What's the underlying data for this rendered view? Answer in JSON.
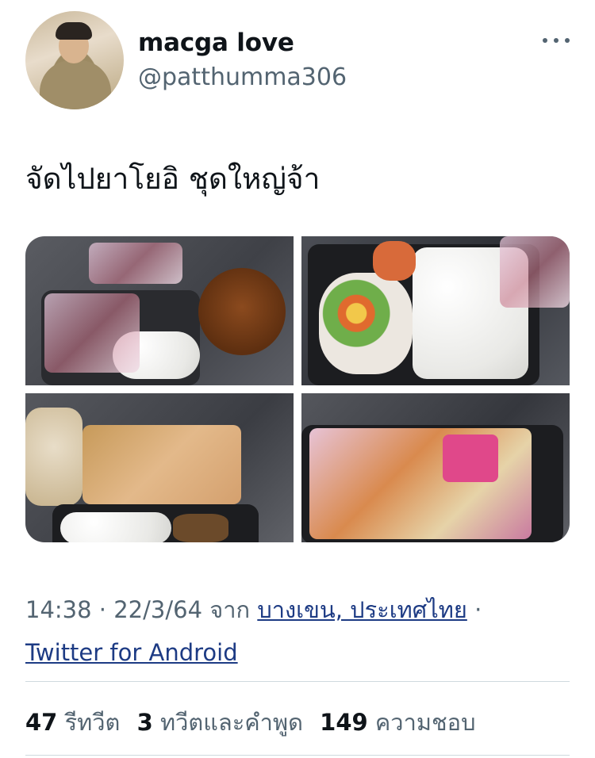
{
  "tweet": {
    "display_name": "macga love",
    "handle": "@patthumma306",
    "text": "จัดไปยาโยอิ ชุดใหญ่จ้า",
    "time": "14:38",
    "separator": "·",
    "date": "22/3/64",
    "from_label": "จาก",
    "location": "บางเขน, ประเทศไทย",
    "client": "Twitter for Android"
  },
  "stats": {
    "retweets_count": "47",
    "retweets_label": "รีทวีต",
    "quotes_count": "3",
    "quotes_label": "ทวีตและคำพูด",
    "likes_count": "149",
    "likes_label": "ความชอบ"
  },
  "media": [
    {
      "icon": "food-photo-bento-boxes"
    },
    {
      "icon": "food-photo-rice-salad-tray"
    },
    {
      "icon": "food-photo-rice-and-sides"
    },
    {
      "icon": "food-photo-wrapped-noodles"
    }
  ],
  "colors": {
    "text": "#0f1419",
    "secondary": "#536471",
    "link": "#1d3b84",
    "divider": "#cfd9de"
  }
}
